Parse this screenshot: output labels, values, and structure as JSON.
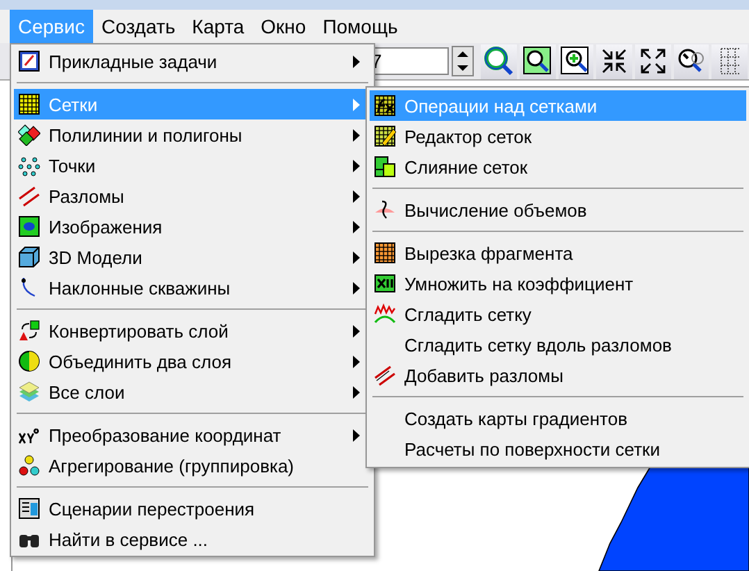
{
  "menubar": [
    {
      "label": "Сервис",
      "selected": true
    },
    {
      "label": "Создать",
      "selected": false
    },
    {
      "label": "Карта",
      "selected": false
    },
    {
      "label": "Окно",
      "selected": false
    },
    {
      "label": "Помощь",
      "selected": false
    }
  ],
  "toolbar": {
    "scale_value": "7"
  },
  "service_menu": [
    {
      "kind": "item",
      "label": "Прикладные задачи",
      "submenu": true,
      "selected": false
    },
    {
      "kind": "separator"
    },
    {
      "kind": "item",
      "label": "Сетки",
      "submenu": true,
      "selected": true
    },
    {
      "kind": "item",
      "label": "Полилинии и полигоны",
      "submenu": true,
      "selected": false
    },
    {
      "kind": "item",
      "label": "Точки",
      "submenu": true,
      "selected": false
    },
    {
      "kind": "item",
      "label": "Разломы",
      "submenu": true,
      "selected": false
    },
    {
      "kind": "item",
      "label": "Изображения",
      "submenu": true,
      "selected": false
    },
    {
      "kind": "item",
      "label": "3D Модели",
      "submenu": true,
      "selected": false
    },
    {
      "kind": "item",
      "label": "Наклонные скважины",
      "submenu": true,
      "selected": false
    },
    {
      "kind": "separator"
    },
    {
      "kind": "item",
      "label": "Конвертировать слой",
      "submenu": true,
      "selected": false
    },
    {
      "kind": "item",
      "label": "Объединить два слоя",
      "submenu": true,
      "selected": false
    },
    {
      "kind": "item",
      "label": "Все слои",
      "submenu": true,
      "selected": false
    },
    {
      "kind": "separator"
    },
    {
      "kind": "item",
      "label": "Преобразование координат",
      "submenu": true,
      "selected": false
    },
    {
      "kind": "item",
      "label": "Агрегирование (группировка)",
      "submenu": false,
      "selected": false
    },
    {
      "kind": "separator"
    },
    {
      "kind": "item",
      "label": "Сценарии перестроения",
      "submenu": false,
      "selected": false
    },
    {
      "kind": "item",
      "label": "Найти в сервисе ...",
      "submenu": false,
      "selected": false
    }
  ],
  "grids_submenu": [
    {
      "kind": "item",
      "label": "Операции над сетками",
      "selected": true
    },
    {
      "kind": "item",
      "label": "Редактор сеток",
      "selected": false
    },
    {
      "kind": "item",
      "label": "Слияние сеток",
      "selected": false
    },
    {
      "kind": "separator"
    },
    {
      "kind": "item",
      "label": "Вычисление объемов",
      "selected": false
    },
    {
      "kind": "separator"
    },
    {
      "kind": "item",
      "label": "Вырезка фрагмента",
      "selected": false
    },
    {
      "kind": "item",
      "label": "Умножить на коэффициент",
      "selected": false
    },
    {
      "kind": "item",
      "label": "Сгладить сетку",
      "selected": false
    },
    {
      "kind": "item",
      "label": "Сгладить сетку вдоль разломов",
      "selected": false
    },
    {
      "kind": "item",
      "label": "Добавить разломы",
      "selected": false
    },
    {
      "kind": "separator"
    },
    {
      "kind": "item",
      "label": "Создать карты градиентов",
      "selected": false
    },
    {
      "kind": "item",
      "label": "Расчеты по поверхности сетки",
      "selected": false
    }
  ]
}
